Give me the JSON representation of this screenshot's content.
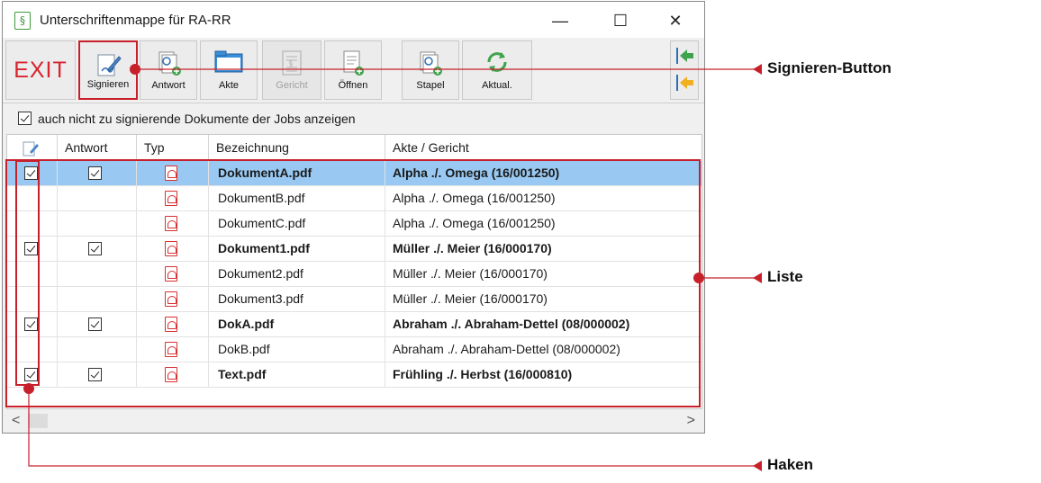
{
  "window": {
    "title": "Unterschriftenmappe für RA-RR",
    "minimize": "—",
    "maximize": "☐",
    "close": "✕"
  },
  "toolbar": {
    "exit": "EXIT",
    "buttons": [
      {
        "label": "Signieren",
        "icon": "sign-pen-icon"
      },
      {
        "label": "Antwort",
        "icon": "reply-docs-icon"
      },
      {
        "label": "Akte",
        "icon": "folder-icon"
      },
      {
        "label": "Gericht",
        "icon": "court-doc-icon",
        "disabled": true
      },
      {
        "label": "Öffnen",
        "icon": "open-doc-icon"
      },
      {
        "label": "Stapel",
        "icon": "stack-docs-icon"
      },
      {
        "label": "Aktual.",
        "icon": "refresh-icon"
      }
    ]
  },
  "options": {
    "show_all_label": "auch nicht zu signierende Dokumente der Jobs anzeigen",
    "show_all_checked": true
  },
  "grid": {
    "columns": [
      "",
      "Antwort",
      "Typ",
      "Bezeichnung",
      "Akte / Gericht"
    ],
    "rows": [
      {
        "sign": true,
        "antwort": true,
        "name": "DokumentA.pdf",
        "akte": "Alpha ./. Omega (16/001250)",
        "bold": true,
        "selected": true
      },
      {
        "sign": false,
        "antwort": false,
        "name": "DokumentB.pdf",
        "akte": "Alpha ./. Omega (16/001250)",
        "bold": false,
        "selected": false
      },
      {
        "sign": false,
        "antwort": false,
        "name": "DokumentC.pdf",
        "akte": "Alpha ./. Omega (16/001250)",
        "bold": false,
        "selected": false
      },
      {
        "sign": true,
        "antwort": true,
        "name": "Dokument1.pdf",
        "akte": "Müller ./. Meier (16/000170)",
        "bold": true,
        "selected": false
      },
      {
        "sign": false,
        "antwort": false,
        "name": "Dokument2.pdf",
        "akte": "Müller ./. Meier (16/000170)",
        "bold": false,
        "selected": false
      },
      {
        "sign": false,
        "antwort": false,
        "name": "Dokument3.pdf",
        "akte": "Müller ./. Meier (16/000170)",
        "bold": false,
        "selected": false
      },
      {
        "sign": true,
        "antwort": true,
        "name": "DokA.pdf",
        "akte": "Abraham ./. Abraham-Dettel (08/000002)",
        "bold": true,
        "selected": false
      },
      {
        "sign": false,
        "antwort": false,
        "name": "DokB.pdf",
        "akte": "Abraham ./. Abraham-Dettel (08/000002)",
        "bold": false,
        "selected": false
      },
      {
        "sign": true,
        "antwort": true,
        "name": "Text.pdf",
        "akte": "Frühling ./. Herbst (16/000810)",
        "bold": true,
        "selected": false
      }
    ]
  },
  "scrollbar": {
    "left": "<",
    "right": ">"
  },
  "callouts": {
    "sign_button": "Signieren-Button",
    "list": "Liste",
    "checks": "Haken"
  },
  "colors": {
    "accent_red": "#c8202a",
    "selection": "#99c9f2",
    "exit_red": "#d9232e"
  }
}
